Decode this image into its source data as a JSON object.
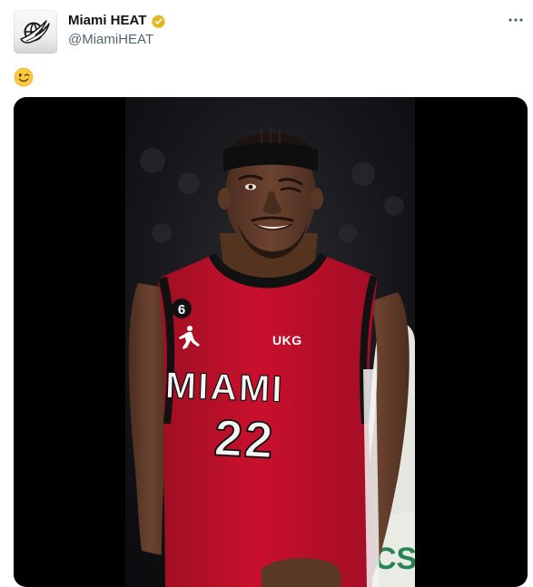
{
  "author": {
    "display_name": "Miami HEAT",
    "handle": "@MiamiHEAT",
    "verified_badge": "gold-verified-badge",
    "avatar_icon": "miami-heat-flaming-ball-logo"
  },
  "header": {
    "more_icon": "more-horizontal-icon"
  },
  "tweet": {
    "text": "😉",
    "emoji_icon": "winking-face-emoji"
  },
  "media": {
    "photo_subject": "basketball-player-winking",
    "jersey": {
      "team_text": "MIAMI",
      "number": "22",
      "patch_number": "6",
      "sponsor": "UKG"
    }
  },
  "colors": {
    "text_primary": "#0f1419",
    "text_secondary": "#536471",
    "verified_gold": "#e2b719",
    "jersey_red": "#c8102e",
    "media_background": "#000000"
  }
}
